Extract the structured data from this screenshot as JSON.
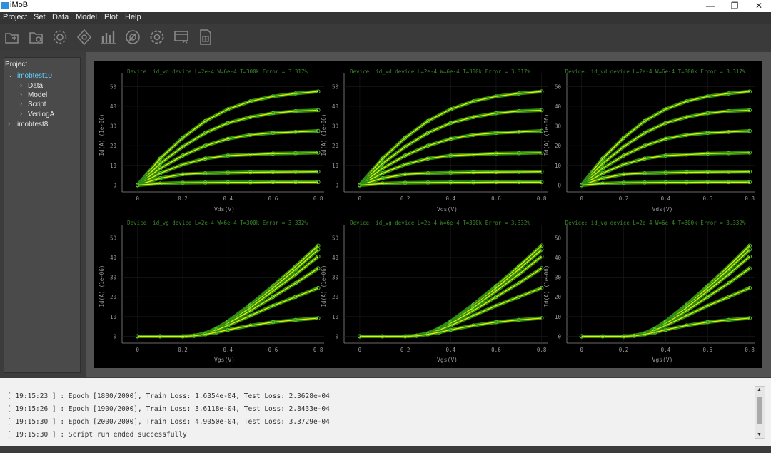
{
  "app": {
    "title": "iMoB"
  },
  "menu": [
    "Project",
    "Set",
    "Data",
    "Model",
    "Plot",
    "Help"
  ],
  "toolbar_icons": [
    "new-project-icon",
    "open-folder-icon",
    "settings-gear-icon",
    "model-gear-icon",
    "bar-chart-icon",
    "target-icon",
    "gear-cog-icon",
    "screen-export-icon",
    "spreadsheet-icon"
  ],
  "project_tree": {
    "header": "Project",
    "projects": [
      {
        "name": "imobtest10",
        "expanded": true,
        "children": [
          "Data",
          "Model",
          "Script",
          "VerilogA"
        ]
      },
      {
        "name": "imobtest8",
        "expanded": false,
        "children": []
      }
    ]
  },
  "plots": {
    "output_title": "Device: id_vd device L=2e-4 W=6e-4 T=300k Error = 3.317%",
    "transfer_title": "Device: id_vg device L=2e-4 W=6e-4 T=300k Error = 3.332%",
    "output_xlabel": "Vds(V)",
    "output_ylabel": "Id(A) (1e-06)",
    "transfer_xlabel": "Vgs(V)",
    "transfer_ylabel": "Id(A) (1e-06)",
    "xticks": [
      "0",
      "0.2",
      "0.4",
      "0.6",
      "0.8"
    ],
    "yticks": [
      "0",
      "10",
      "20",
      "30",
      "40",
      "50"
    ]
  },
  "chart_data": [
    {
      "type": "line",
      "title": "Device: id_vd device L=2e-4 W=6e-4 T=300k Error = 3.317%",
      "xlabel": "Vds(V)",
      "ylabel": "Id(A) (1e-06)",
      "xlim": [
        -0.05,
        0.82
      ],
      "ylim": [
        -2,
        53
      ],
      "x": [
        0,
        0.1,
        0.2,
        0.3,
        0.4,
        0.5,
        0.6,
        0.7,
        0.8
      ],
      "series": [
        {
          "values": [
            0,
            13.5,
            24,
            32.5,
            38.5,
            42.5,
            45,
            46.5,
            47.5
          ]
        },
        {
          "values": [
            0,
            11,
            19.5,
            26.5,
            31.5,
            34.5,
            36.5,
            37.5,
            38
          ]
        },
        {
          "values": [
            0,
            8.5,
            15,
            20,
            23.5,
            25.5,
            26.5,
            27,
            27.5
          ]
        },
        {
          "values": [
            0,
            6,
            10.5,
            13.5,
            15,
            15.5,
            16,
            16.2,
            16.5
          ]
        },
        {
          "values": [
            0,
            3.5,
            5.5,
            6,
            6.3,
            6.5,
            6.6,
            6.7,
            6.8
          ]
        },
        {
          "values": [
            0,
            0.8,
            1.2,
            1.3,
            1.4,
            1.4,
            1.5,
            1.5,
            1.5
          ]
        }
      ]
    },
    {
      "type": "line",
      "title": "Device: id_vd device L=2e-4 W=6e-4 T=300k Error = 3.317%",
      "xlabel": "Vds(V)",
      "ylabel": "Id(A) (1e-06)",
      "xlim": [
        -0.05,
        0.82
      ],
      "ylim": [
        -2,
        53
      ],
      "x": [
        0,
        0.1,
        0.2,
        0.3,
        0.4,
        0.5,
        0.6,
        0.7,
        0.8
      ],
      "series": [
        {
          "values": [
            0,
            13.5,
            24,
            32.5,
            38.5,
            42.5,
            45,
            46.5,
            47.5
          ]
        },
        {
          "values": [
            0,
            11,
            19.5,
            26.5,
            31.5,
            34.5,
            36.5,
            37.5,
            38
          ]
        },
        {
          "values": [
            0,
            8.5,
            15,
            20,
            23.5,
            25.5,
            26.5,
            27,
            27.5
          ]
        },
        {
          "values": [
            0,
            6,
            10.5,
            13.5,
            15,
            15.5,
            16,
            16.2,
            16.5
          ]
        },
        {
          "values": [
            0,
            3.5,
            5.5,
            6,
            6.3,
            6.5,
            6.6,
            6.7,
            6.8
          ]
        },
        {
          "values": [
            0,
            0.8,
            1.2,
            1.3,
            1.4,
            1.4,
            1.5,
            1.5,
            1.5
          ]
        }
      ]
    },
    {
      "type": "line",
      "title": "Device: id_vd device L=2e-4 W=6e-4 T=300k Error = 3.317%",
      "xlabel": "Vds(V)",
      "ylabel": "Id(A) (1e-06)",
      "xlim": [
        -0.05,
        0.82
      ],
      "ylim": [
        -2,
        53
      ],
      "x": [
        0,
        0.1,
        0.2,
        0.3,
        0.4,
        0.5,
        0.6,
        0.7,
        0.8
      ],
      "series": [
        {
          "values": [
            0,
            13.5,
            24,
            32.5,
            38.5,
            42.5,
            45,
            46.5,
            47.5
          ]
        },
        {
          "values": [
            0,
            11,
            19.5,
            26.5,
            31.5,
            34.5,
            36.5,
            37.5,
            38
          ]
        },
        {
          "values": [
            0,
            8.5,
            15,
            20,
            23.5,
            25.5,
            26.5,
            27,
            27.5
          ]
        },
        {
          "values": [
            0,
            6,
            10.5,
            13.5,
            15,
            15.5,
            16,
            16.2,
            16.5
          ]
        },
        {
          "values": [
            0,
            3.5,
            5.5,
            6,
            6.3,
            6.5,
            6.6,
            6.7,
            6.8
          ]
        },
        {
          "values": [
            0,
            0.8,
            1.2,
            1.3,
            1.4,
            1.4,
            1.5,
            1.5,
            1.5
          ]
        }
      ]
    },
    {
      "type": "line",
      "title": "Device: id_vg device L=2e-4 W=6e-4 T=300k Error = 3.332%",
      "xlabel": "Vgs(V)",
      "ylabel": "Id(A) (1e-06)",
      "xlim": [
        -0.05,
        0.82
      ],
      "ylim": [
        -2,
        53
      ],
      "x": [
        0,
        0.1,
        0.2,
        0.25,
        0.3,
        0.35,
        0.4,
        0.5,
        0.6,
        0.7,
        0.8
      ],
      "series": [
        {
          "values": [
            0,
            0,
            0,
            0.3,
            1.5,
            4,
            7.5,
            16,
            25.5,
            35.5,
            46
          ]
        },
        {
          "values": [
            0,
            0,
            0,
            0.3,
            1.5,
            4,
            7.5,
            15.5,
            24.5,
            34,
            44
          ]
        },
        {
          "values": [
            0,
            0,
            0,
            0.3,
            1.5,
            3.8,
            7,
            14.5,
            23,
            31.5,
            40.5
          ]
        },
        {
          "values": [
            0,
            0,
            0,
            0.3,
            1.4,
            3.6,
            6.5,
            13,
            20,
            27,
            34.5
          ]
        },
        {
          "values": [
            0,
            0,
            0,
            0.3,
            1.3,
            3.2,
            5.5,
            10.5,
            15.5,
            20,
            24.5
          ]
        },
        {
          "values": [
            0,
            0,
            0,
            0.2,
            1,
            2,
            3.3,
            5.5,
            7.2,
            8.3,
            9.2
          ]
        }
      ]
    },
    {
      "type": "line",
      "title": "Device: id_vg device L=2e-4 W=6e-4 T=300k Error = 3.332%",
      "xlabel": "Vgs(V)",
      "ylabel": "Id(A) (1e-06)",
      "xlim": [
        -0.05,
        0.82
      ],
      "ylim": [
        -2,
        53
      ],
      "x": [
        0,
        0.1,
        0.2,
        0.25,
        0.3,
        0.35,
        0.4,
        0.5,
        0.6,
        0.7,
        0.8
      ],
      "series": [
        {
          "values": [
            0,
            0,
            0,
            0.3,
            1.5,
            4,
            7.5,
            16,
            25.5,
            35.5,
            46
          ]
        },
        {
          "values": [
            0,
            0,
            0,
            0.3,
            1.5,
            4,
            7.5,
            15.5,
            24.5,
            34,
            44
          ]
        },
        {
          "values": [
            0,
            0,
            0,
            0.3,
            1.5,
            3.8,
            7,
            14.5,
            23,
            31.5,
            40.5
          ]
        },
        {
          "values": [
            0,
            0,
            0,
            0.3,
            1.4,
            3.6,
            6.5,
            13,
            20,
            27,
            34.5
          ]
        },
        {
          "values": [
            0,
            0,
            0,
            0.3,
            1.3,
            3.2,
            5.5,
            10.5,
            15.5,
            20,
            24.5
          ]
        },
        {
          "values": [
            0,
            0,
            0,
            0.2,
            1,
            2,
            3.3,
            5.5,
            7.2,
            8.3,
            9.2
          ]
        }
      ]
    },
    {
      "type": "line",
      "title": "Device: id_vg device L=2e-4 W=6e-4 T=300k Error = 3.332%",
      "xlabel": "Vgs(V)",
      "ylabel": "Id(A) (1e-06)",
      "xlim": [
        -0.05,
        0.82
      ],
      "ylim": [
        -2,
        53
      ],
      "x": [
        0,
        0.1,
        0.2,
        0.25,
        0.3,
        0.35,
        0.4,
        0.5,
        0.6,
        0.7,
        0.8
      ],
      "series": [
        {
          "values": [
            0,
            0,
            0,
            0.3,
            1.5,
            4,
            7.5,
            16,
            25.5,
            35.5,
            46
          ]
        },
        {
          "values": [
            0,
            0,
            0,
            0.3,
            1.5,
            4,
            7.5,
            15.5,
            24.5,
            34,
            44
          ]
        },
        {
          "values": [
            0,
            0,
            0,
            0.3,
            1.5,
            3.8,
            7,
            14.5,
            23,
            31.5,
            40.5
          ]
        },
        {
          "values": [
            0,
            0,
            0,
            0.3,
            1.4,
            3.6,
            6.5,
            13,
            20,
            27,
            34.5
          ]
        },
        {
          "values": [
            0,
            0,
            0,
            0.3,
            1.3,
            3.2,
            5.5,
            10.5,
            15.5,
            20,
            24.5
          ]
        },
        {
          "values": [
            0,
            0,
            0,
            0.2,
            1,
            2,
            3.3,
            5.5,
            7.2,
            8.3,
            9.2
          ]
        }
      ]
    }
  ],
  "colors": {
    "curve_outer": "#2e8b14",
    "curve_inner": "#e8f000",
    "title_green": "#3a8a2a",
    "axis": "#8a8a8a"
  },
  "console": [
    "[ 19:15:23 ] : Epoch [1800/2000], Train Loss: 1.6354e-04, Test Loss: 2.3628e-04",
    "[ 19:15:26 ] : Epoch [1900/2000], Train Loss: 3.6118e-04, Test Loss: 2.8433e-04",
    "[ 19:15:30 ] : Epoch [2000/2000], Train Loss: 4.9050e-04, Test Loss: 3.3729e-04",
    "[ 19:15:30 ] : Script run ended successfully"
  ]
}
